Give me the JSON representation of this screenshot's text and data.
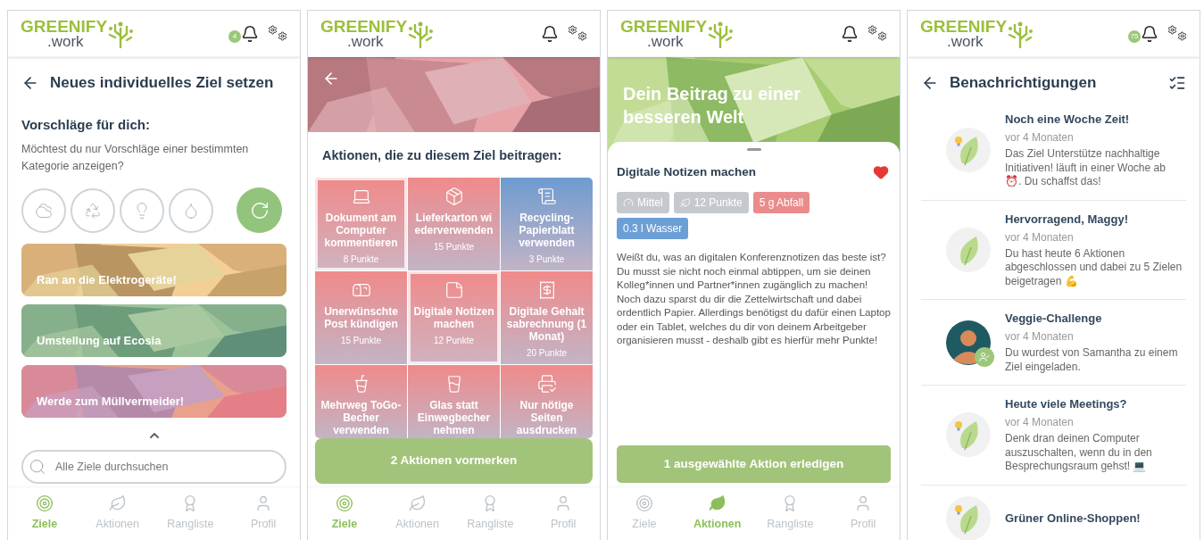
{
  "new_goal_screen": {
    "header": {
      "logo_name": "GREENIFY",
      "logo_suffix": ".work",
      "notification_badge": "4"
    },
    "title": "Neues individuelles Ziel setzen",
    "suggestions_heading": "Vorschläge für dich:",
    "suggestions_hint": "Möchtest du nur Vorschläge einer bestimmten Kategorie anzeigen?",
    "suggestions": [
      {
        "label": "Ran an die Elektrogeräte!",
        "kind": "picture"
      },
      {
        "label": "Umstellung auf Ecosia",
        "kind": "picture"
      },
      {
        "label": "Werde zum Müllvermeider!",
        "kind": "picture"
      }
    ],
    "search": {
      "placeholder": "Alle Ziele durchsuchen"
    },
    "bottom_nav": [
      {
        "label": "Ziele",
        "selected": true
      },
      {
        "label": "Aktionen",
        "selected": false
      },
      {
        "label": "Rangliste",
        "selected": false
      },
      {
        "label": "Profil",
        "selected": false
      }
    ]
  },
  "goal_actions_screen": {
    "header": {
      "logo_name": "GREENIFY",
      "logo_suffix": ".work"
    },
    "heading": "Aktionen, die zu diesem Ziel beitragen:",
    "actions": [
      {
        "label": "Dokument am Computer kommentieren",
        "points": "8 Punkte",
        "color": "#f08a8a",
        "selected": true
      },
      {
        "label": "Lieferkarton wi ederverwenden",
        "points": "15 Punkte",
        "color": "#f08a8a",
        "selected": false
      },
      {
        "label": "Recycling-Papierblatt verwenden",
        "points": "3 Punkte",
        "color": "#6e9bd0",
        "selected": false
      },
      {
        "label": "Unerwünschte Post kündigen",
        "points": "15 Punkte",
        "color": "#f08a8a",
        "selected": false
      },
      {
        "label": "Digitale Notizen machen",
        "points": "12 Punkte",
        "color": "#f08a8a",
        "selected": true
      },
      {
        "label": "Digitale Gehalt sabrechnung (1 Monat)",
        "points": "20 Punkte",
        "color": "#f08a8a",
        "selected": false
      },
      {
        "label": "Mehrweg ToGo-Becher verwenden",
        "color": "#f08a8a",
        "selected": false
      },
      {
        "label": "Glas statt Einwegbecher nehmen",
        "color": "#f08a8a",
        "selected": false
      },
      {
        "label": "Nur nötige Seiten ausdrucken",
        "color": "#f08a8a",
        "selected": false
      }
    ],
    "primary_button": "2 Aktionen vormerken",
    "bottom_nav": [
      {
        "label": "Ziele",
        "selected": true
      },
      {
        "label": "Aktionen",
        "selected": false
      },
      {
        "label": "Rangliste",
        "selected": false
      },
      {
        "label": "Profil",
        "selected": false
      }
    ]
  },
  "action_detail_screen": {
    "header": {
      "logo_name": "GREENIFY",
      "logo_suffix": ".work"
    },
    "banner_title": "Dein Beitrag zu einer besseren Welt",
    "action_title": "Digitale Notizen machen",
    "favorite": true,
    "tags": [
      {
        "label": "Mittel",
        "kind": "difficulty",
        "color": "#c5c9cd"
      },
      {
        "label": "12 Punkte",
        "kind": "points",
        "color": "#c5c9cd"
      },
      {
        "label": "5 g Abfall",
        "kind": "waste",
        "color": "#ea8c8c"
      },
      {
        "label": "0.3 l Wasser",
        "kind": "water",
        "color": "#6c9fd6"
      }
    ],
    "description": "Weißt du, was an digitalen Konferenznotizen das beste ist? Du musst sie nicht noch einmal abtippen, um sie deinen Kolleg*innen und Partner*innen zugänglich zu machen! Noch dazu sparst du dir die Zettelwirtschaft und dabei ordentlich Papier. Allerdings benötigst du dafür einen Laptop oder ein Tablet, welches du dir von deinem Arbeitgeber organisieren musst - deshalb gibt es hierfür mehr Punkte!",
    "primary_button": "1 ausgewählte Aktion erledigen",
    "bottom_nav": [
      {
        "label": "Ziele",
        "selected": false
      },
      {
        "label": "Aktionen",
        "selected": true
      },
      {
        "label": "Rangliste",
        "selected": false
      },
      {
        "label": "Profil",
        "selected": false
      }
    ]
  },
  "notifications_screen": {
    "header": {
      "logo_name": "GREENIFY",
      "logo_suffix": ".work",
      "notification_badge": "75"
    },
    "title": "Benachrichtigungen",
    "notifications": [
      {
        "kind": "tip",
        "title": "Noch eine Woche Zeit!",
        "time": "vor 4 Monaten",
        "text": "Das Ziel Unterstütze nachhaltige Initiativen! läuft in einer Woche ab ⏰. Du schaffst das!"
      },
      {
        "kind": "praise",
        "title": "Hervorragend, Maggy!",
        "time": "vor 4 Monaten",
        "text": "Du hast heute 6 Aktionen abgeschlossen und dabei zu 5 Zielen beigetragen 💪"
      },
      {
        "kind": "invite",
        "title": "Veggie-Challenge",
        "time": "vor 4 Monaten",
        "text": "Du wurdest von Samantha zu einem Ziel eingeladen."
      },
      {
        "kind": "tip",
        "title": "Heute viele Meetings?",
        "time": "vor 4 Monaten",
        "text": "Denk dran deinen Computer auszuschalten, wenn du in den Besprechungsraum gehst! 💻"
      },
      {
        "kind": "tip",
        "title": "Grüner Online-Shoppen!"
      }
    ]
  }
}
